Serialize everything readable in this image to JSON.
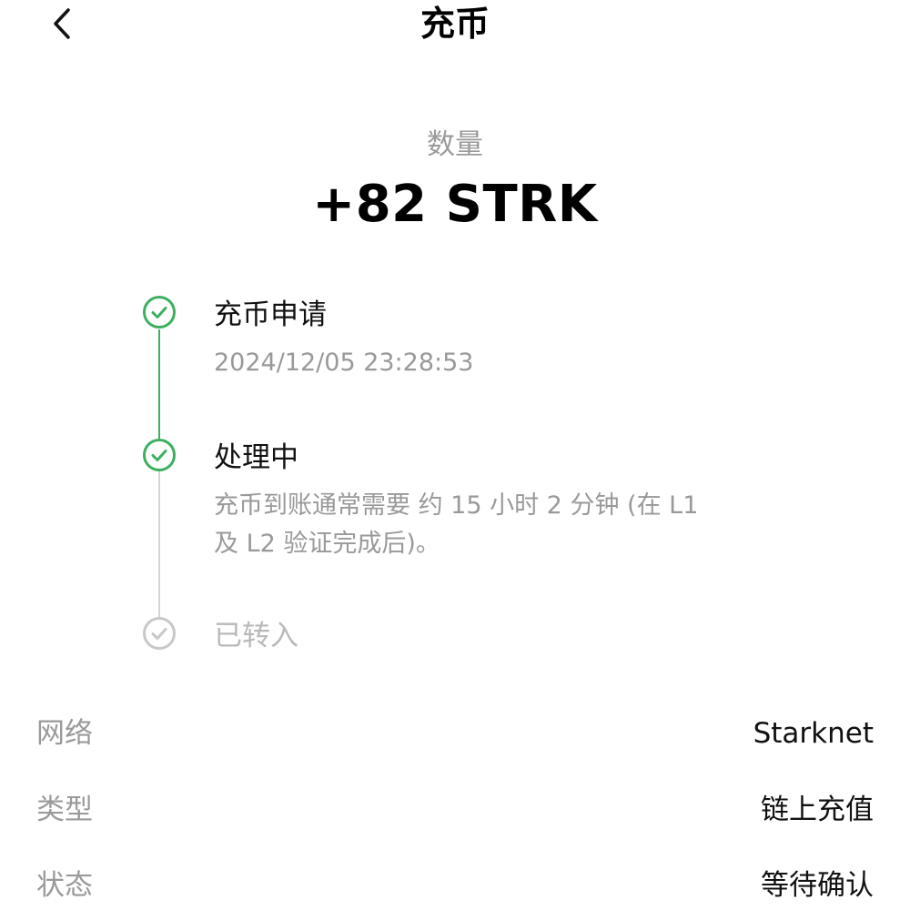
{
  "header": {
    "title": "充币",
    "back_icon": "chevron-left-icon"
  },
  "amount": {
    "label": "数量",
    "value": "+82 STRK"
  },
  "timeline": {
    "colors": {
      "done": "#3db060",
      "pending": "#c8c8c8"
    },
    "steps": [
      {
        "title": "充币申请",
        "subtitle": "2024/12/05 23:28:53",
        "status": "done"
      },
      {
        "title": "处理中",
        "subtitle_line1": "充币到账通常需要 约 15 小时 2 分钟 (在 L1",
        "subtitle_line2": "及 L2 验证完成后)。",
        "status": "done"
      },
      {
        "title": "已转入",
        "status": "pending"
      }
    ]
  },
  "details": [
    {
      "label": "网络",
      "value": "Starknet"
    },
    {
      "label": "类型",
      "value": "链上充值"
    },
    {
      "label": "状态",
      "value": "等待确认"
    }
  ]
}
